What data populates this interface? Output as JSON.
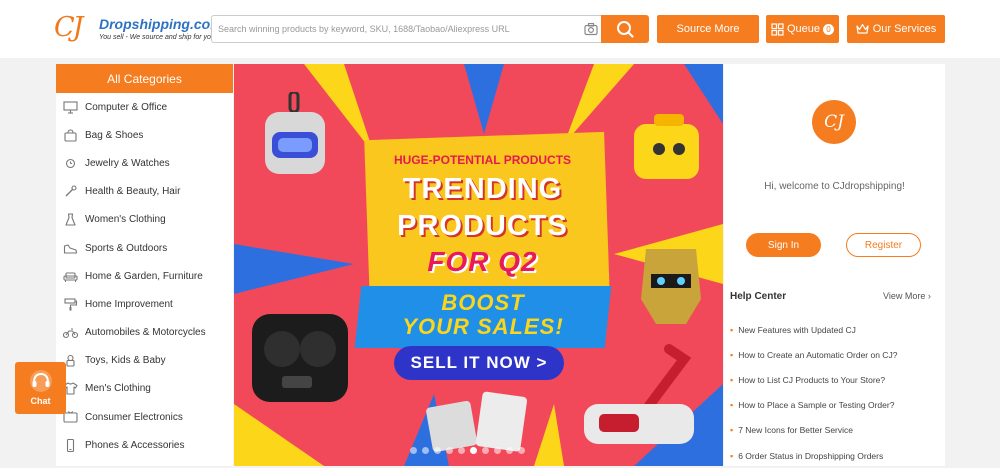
{
  "header": {
    "logo_mark": "CJ",
    "logo_name": "Dropshipping.com",
    "logo_tagline": "You sell - We source and ship for you!",
    "search_placeholder": "Search winning products by keyword, SKU, 1688/Taobao/Aliexpress URL",
    "source_more": "Source More",
    "queue": "Queue",
    "queue_count": "0",
    "our_services": "Our Services"
  },
  "sidebar": {
    "title": "All Categories",
    "items": [
      {
        "label": "Computer & Office",
        "icon": "monitor-icon"
      },
      {
        "label": "Bag & Shoes",
        "icon": "bag-icon"
      },
      {
        "label": "Jewelry & Watches",
        "icon": "watch-icon"
      },
      {
        "label": "Health & Beauty, Hair",
        "icon": "brush-icon"
      },
      {
        "label": "Women's Clothing",
        "icon": "dress-icon"
      },
      {
        "label": "Sports & Outdoors",
        "icon": "shoe-icon"
      },
      {
        "label": "Home & Garden, Furniture",
        "icon": "sofa-icon"
      },
      {
        "label": "Home Improvement",
        "icon": "roller-icon"
      },
      {
        "label": "Automobiles & Motorcycles",
        "icon": "motorcycle-icon"
      },
      {
        "label": "Toys, Kids & Baby",
        "icon": "toy-icon"
      },
      {
        "label": "Men's Clothing",
        "icon": "shirt-icon"
      },
      {
        "label": "Consumer Electronics",
        "icon": "tv-icon"
      },
      {
        "label": "Phones & Accessories",
        "icon": "phone-icon"
      }
    ]
  },
  "banner": {
    "line1": "HUGE-POTENTIAL PRODUCTS",
    "line2": "TRENDING",
    "line3": "PRODUCTS",
    "line4": "FOR Q2",
    "line5": "BOOST",
    "line6": "YOUR SALES!",
    "cta": "SELL IT NOW >",
    "slide_count": 10,
    "active_slide": 6
  },
  "account": {
    "avatar_text": "CJ",
    "welcome": "Hi, welcome to CJdropshipping!",
    "sign_in": "Sign In",
    "register": "Register"
  },
  "help": {
    "title": "Help Center",
    "view_more": "View More",
    "items": [
      "New Features with Updated CJ",
      "How to Create an Automatic Order on CJ?",
      "How to List CJ Products to Your Store?",
      "How to Place a Sample or Testing Order?",
      "7 New Icons for Better Service",
      "6 Order Status in Dropshipping Orders"
    ]
  },
  "chat": {
    "label": "Chat"
  },
  "colors": {
    "accent": "#f57c1f",
    "banner_bg": "#f2495a",
    "link_blue": "#2d72c4"
  }
}
